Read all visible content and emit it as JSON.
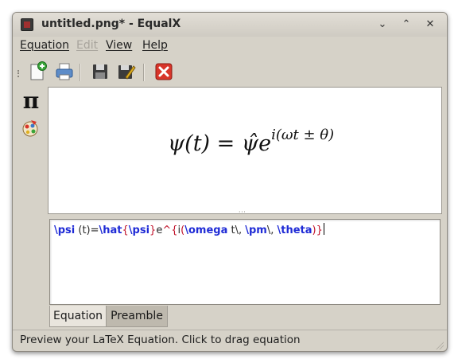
{
  "window": {
    "title": "untitled.png* - EqualX",
    "controls": {
      "minimize": "⌄",
      "maximize": "⌃",
      "close": "✕"
    }
  },
  "menubar": {
    "items": [
      {
        "label": "Equation",
        "enabled": true
      },
      {
        "label": "Edit",
        "enabled": false
      },
      {
        "label": "View",
        "enabled": true
      },
      {
        "label": "Help",
        "enabled": true
      }
    ]
  },
  "toolbar": {
    "tools": [
      "new-file-icon",
      "print-icon",
      "save-icon",
      "save-as-icon",
      "clear-icon"
    ]
  },
  "sidebar": {
    "pi_symbol": "π",
    "icons": [
      "pi-icon",
      "symbols-palette-icon"
    ]
  },
  "preview": {
    "equation_parts": {
      "lhs": "ψ(t) = ",
      "hat_psi": "ψ̂",
      "e": "e",
      "exponent": "i(ωt ± θ)"
    }
  },
  "editor": {
    "tokens": [
      {
        "t": "\\psi",
        "c": "kw"
      },
      {
        "t": " (t)=",
        "c": "tx"
      },
      {
        "t": "\\hat",
        "c": "kw"
      },
      {
        "t": "{",
        "c": "br"
      },
      {
        "t": "\\psi",
        "c": "kw"
      },
      {
        "t": "}",
        "c": "br"
      },
      {
        "t": "e",
        "c": "tx"
      },
      {
        "t": "^",
        "c": "br"
      },
      {
        "t": "{",
        "c": "br"
      },
      {
        "t": "i",
        "c": "tx"
      },
      {
        "t": "(",
        "c": "br"
      },
      {
        "t": "\\omega",
        "c": "kw"
      },
      {
        "t": " t\\, ",
        "c": "tx"
      },
      {
        "t": "\\pm",
        "c": "kw"
      },
      {
        "t": "\\, ",
        "c": "tx"
      },
      {
        "t": "\\theta",
        "c": "kw"
      },
      {
        "t": ")",
        "c": "br"
      },
      {
        "t": "}",
        "c": "br"
      }
    ]
  },
  "tabs": [
    {
      "label": "Equation",
      "active": true
    },
    {
      "label": "Preamble",
      "active": false
    }
  ],
  "status": {
    "text": "Preview your LaTeX Equation. Click to drag equation"
  },
  "colors": {
    "keyword": "#1f2bd6",
    "bracket": "#c0122a",
    "window_bg": "#d6d2c8"
  }
}
